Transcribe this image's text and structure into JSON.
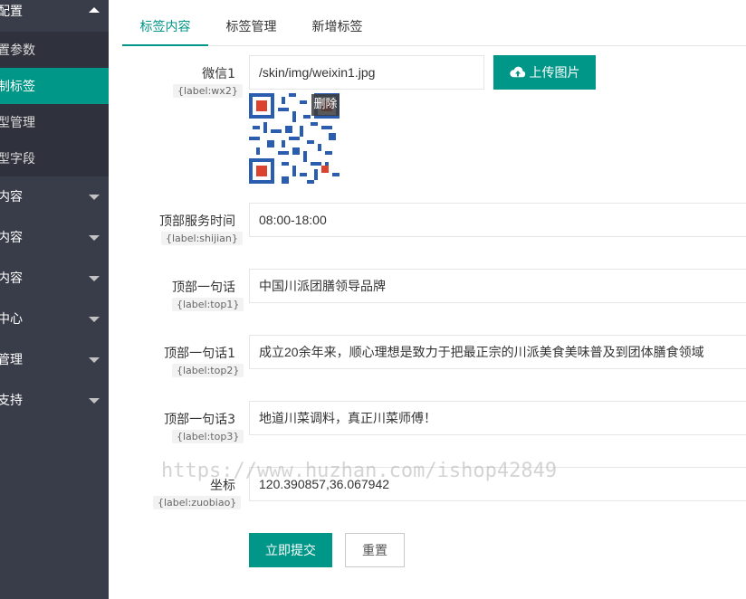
{
  "sidebar": {
    "groups": [
      {
        "label": "配置"
      },
      {
        "label": "内容"
      },
      {
        "label": "内容"
      },
      {
        "label": "内容"
      },
      {
        "label": "中心"
      },
      {
        "label": "管理"
      },
      {
        "label": "支持"
      }
    ],
    "sub_items": [
      {
        "label": "置参数"
      },
      {
        "label": "制标签"
      },
      {
        "label": "型管理"
      },
      {
        "label": "型字段"
      }
    ]
  },
  "tabs": [
    {
      "label": "标签内容"
    },
    {
      "label": "标签管理"
    },
    {
      "label": "新增标签"
    }
  ],
  "form": {
    "wx": {
      "label": "微信1",
      "tag": "{label:wx2}",
      "value": "/skin/img/weixin1.jpg",
      "upload_label": "上传图片",
      "delete_label": "删除"
    },
    "shijian": {
      "label": "顶部服务时间",
      "tag": "{label:shijian}",
      "value": "08:00-18:00"
    },
    "top1": {
      "label": "顶部一句话",
      "tag": "{label:top1}",
      "value": "中国川派团膳领导品牌"
    },
    "top2": {
      "label": "顶部一句话1",
      "tag": "{label:top2}",
      "value": "成立20余年来，顺心理想是致力于把最正宗的川派美食美味普及到团体膳食领域"
    },
    "top3": {
      "label": "顶部一句话3",
      "tag": "{label:top3}",
      "value": "地道川菜调料，真正川菜师傅！"
    },
    "zuobiao": {
      "label": "坐标",
      "tag": "{label:zuobiao}",
      "value": "120.390857,36.067942"
    },
    "submit_label": "立即提交",
    "reset_label": "重置"
  },
  "watermark": "https://www.huzhan.com/ishop42849",
  "colors": {
    "accent": "#009688",
    "sidebar_bg": "#393d49",
    "sidebar_sub_bg": "#2f323c"
  }
}
